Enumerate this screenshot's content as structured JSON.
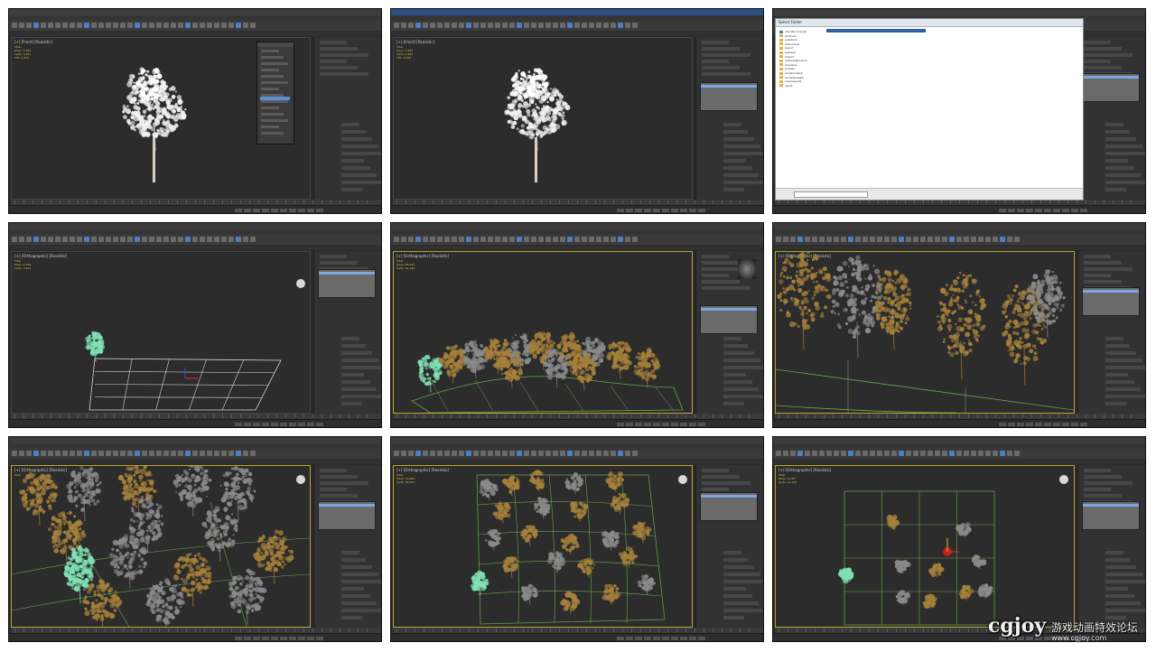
{
  "panels": [
    {
      "id": "p1",
      "viewport_label": "[+] [Front] [Realistic]",
      "stats": [
        "Total",
        "Polys: 1,892",
        "Verts: 3,481",
        "FPS: 1.000"
      ],
      "variant": "front-tree-dialog"
    },
    {
      "id": "p2",
      "viewport_label": "[+] [Front] [Realistic]",
      "stats": [
        "Total",
        "Polys: 1,892",
        "Verts: 3,481",
        "FPS: 1.000"
      ],
      "variant": "front-tree"
    },
    {
      "id": "p3",
      "window_title": "Select Folder",
      "variant": "file-browser",
      "files": [
        {
          "name": "3ds Max Scenes",
          "type": "folder"
        },
        {
          "name": "archives",
          "type": "folder"
        },
        {
          "name": "autoback",
          "type": "folder"
        },
        {
          "name": "downloads",
          "type": "folder"
        },
        {
          "name": "export",
          "type": "folder"
        },
        {
          "name": "express",
          "type": "folder"
        },
        {
          "name": "import",
          "type": "folder"
        },
        {
          "name": "materiallibraries",
          "type": "folder"
        },
        {
          "name": "previews",
          "type": "folder"
        },
        {
          "name": "proxies",
          "type": "folder"
        },
        {
          "name": "renderoutput",
          "type": "folder"
        },
        {
          "name": "renderpresets",
          "type": "folder"
        },
        {
          "name": "sceneassets",
          "type": "folder"
        },
        {
          "name": "vpost",
          "type": "folder"
        }
      ]
    },
    {
      "id": "p4",
      "viewport_label": "[+] [Orthographic] [Realistic]",
      "stats": [
        "Total",
        "Polys: 2,104",
        "Verts: 3,912"
      ],
      "variant": "grid-single"
    },
    {
      "id": "p5",
      "viewport_label": "[+] [Orthographic] [Realistic]",
      "stats": [
        "Total",
        "Polys: 28,447",
        "Verts: 41,120"
      ],
      "variant": "forest-side"
    },
    {
      "id": "p6",
      "viewport_label": "[+] [Orthographic] [Realistic]",
      "stats": [],
      "variant": "forest-close"
    },
    {
      "id": "p7",
      "viewport_label": "[+] [Orthographic] [Realistic]",
      "stats": [
        "Total"
      ],
      "variant": "forest-top-angled"
    },
    {
      "id": "p8",
      "viewport_label": "[+] [Orthographic] [Realistic]",
      "stats": [
        "Total",
        "Polys: 24,882",
        "Verts: 36,004"
      ],
      "variant": "forest-top"
    },
    {
      "id": "p9",
      "viewport_label": "[+] [Orthographic] [Realistic]",
      "stats": [
        "Total",
        "Polys: 9,120",
        "Verts: 12,440"
      ],
      "variant": "grid-sparse"
    }
  ],
  "watermark": {
    "logo": "cgjoy",
    "tagline": "游戏动画特效论坛",
    "url": "www.cgjoy.com"
  },
  "colors": {
    "viewport_bg": "#2c2c2c",
    "tree_autumn": "#a5803a",
    "tree_gray": "#8a8a8a",
    "tree_selected": "#7fe0b4",
    "grid_green": "#6aa84f",
    "grid_white": "#d8d8d8"
  }
}
